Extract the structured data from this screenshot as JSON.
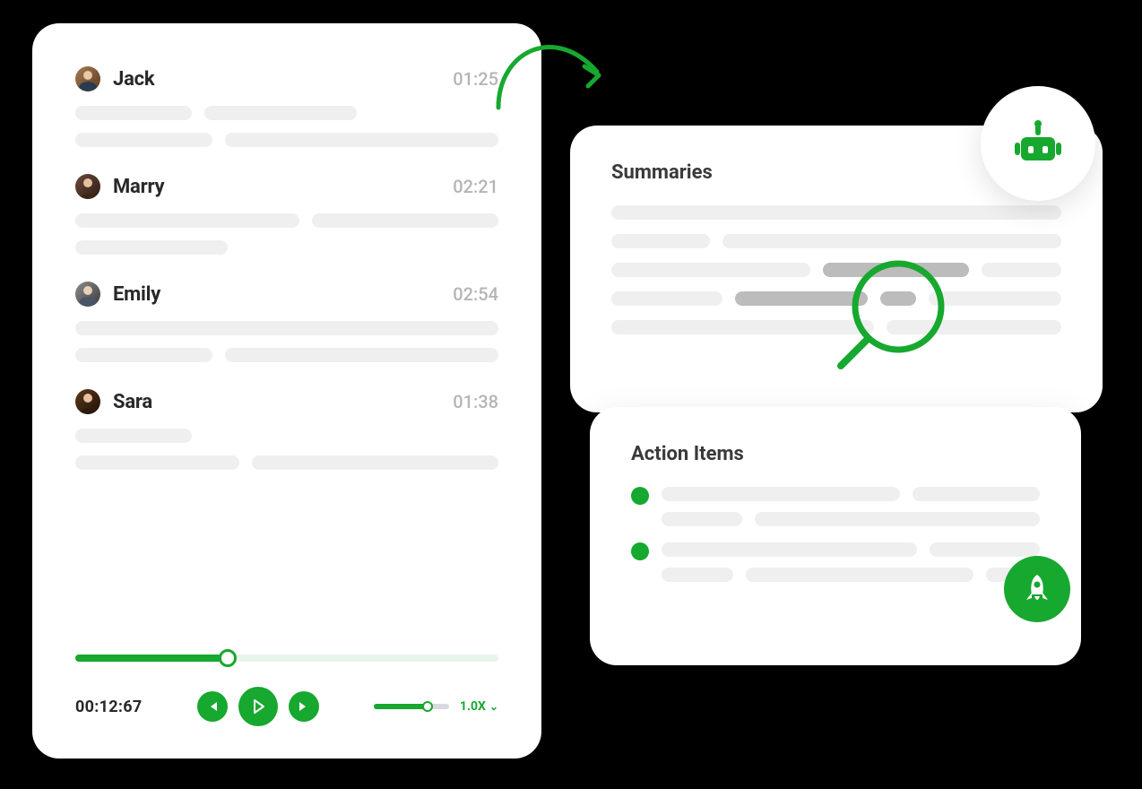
{
  "colors": {
    "accent": "#17a82f"
  },
  "transcript": {
    "entries": [
      {
        "name": "Jack",
        "time": "01:25"
      },
      {
        "name": "Marry",
        "time": "02:21"
      },
      {
        "name": "Emily",
        "time": "02:54"
      },
      {
        "name": "Sara",
        "time": "01:38"
      }
    ]
  },
  "player": {
    "elapsed": "00:12:67",
    "progress_pct": 36,
    "volume_pct": 72,
    "speed_label": "1.0X"
  },
  "summaries": {
    "title": "Summaries"
  },
  "action_items": {
    "title": "Action Items"
  }
}
